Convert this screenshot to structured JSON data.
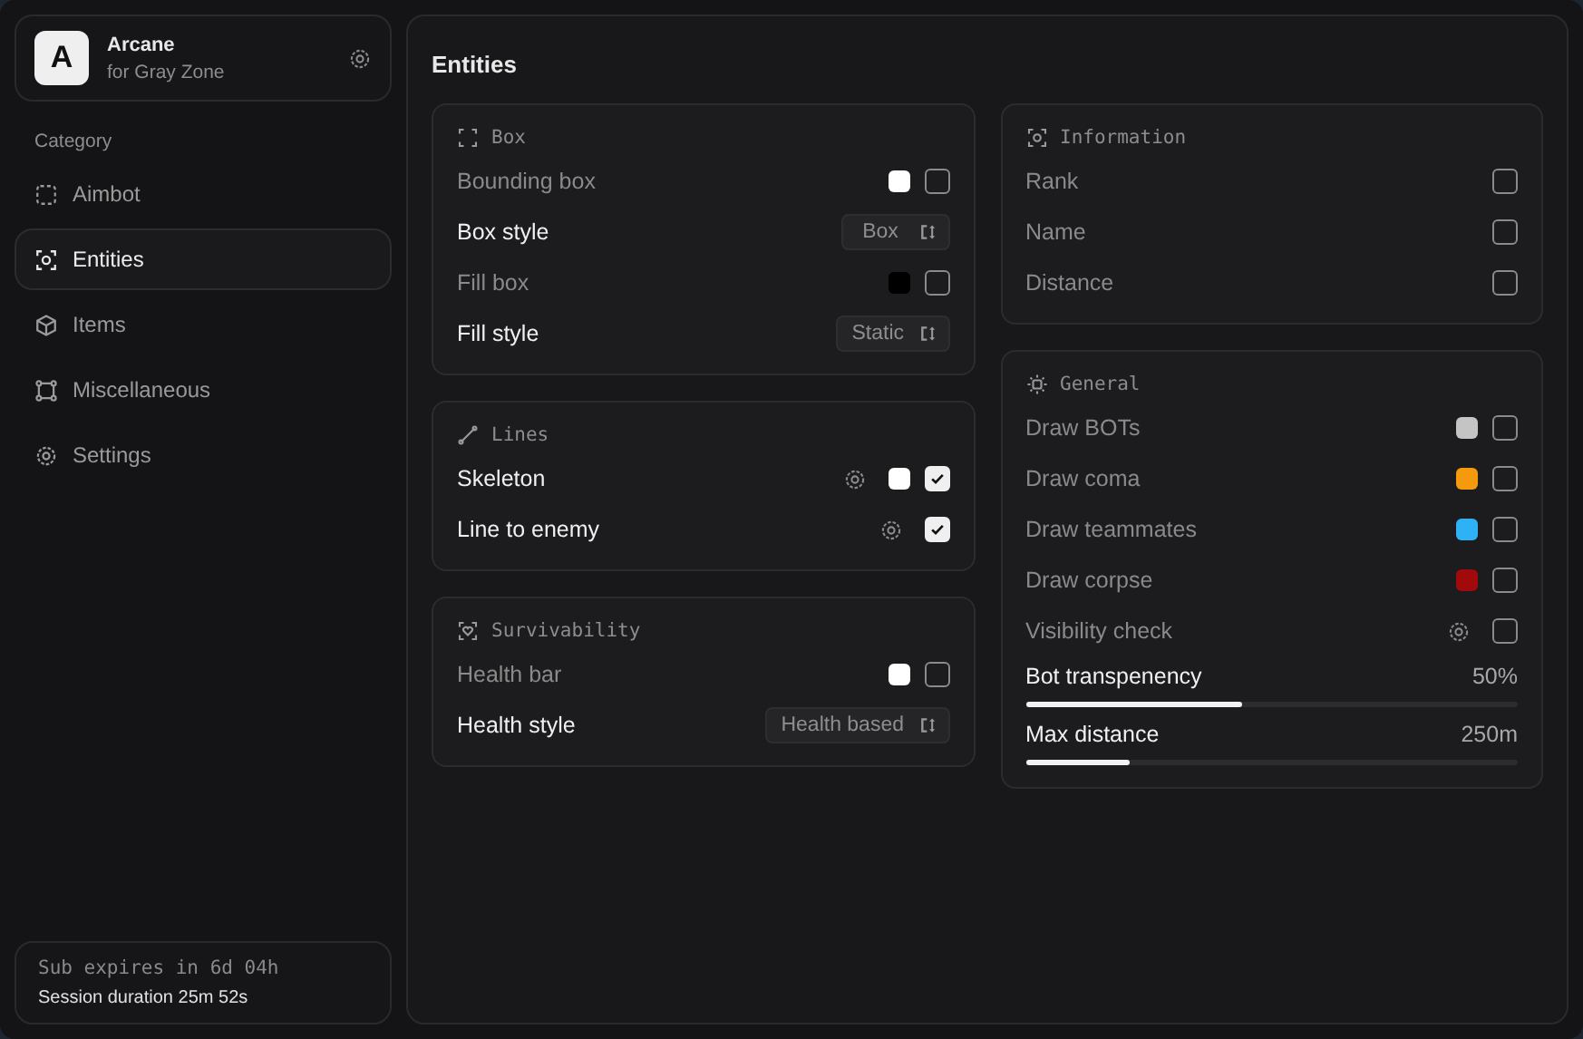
{
  "profile": {
    "logo": "A",
    "name": "Arcane",
    "subtitle": "for Gray Zone"
  },
  "sidebar": {
    "heading": "Category",
    "items": [
      {
        "label": "Aimbot",
        "selected": false
      },
      {
        "label": "Entities",
        "selected": true
      },
      {
        "label": "Items",
        "selected": false
      },
      {
        "label": "Miscellaneous",
        "selected": false
      },
      {
        "label": "Settings",
        "selected": false
      }
    ]
  },
  "footer": {
    "expires": "Sub expires in 6d 04h",
    "session": "Session duration 25m 52s"
  },
  "page_title": "Entities",
  "columns": [
    [
      {
        "title": "Box",
        "rows": [
          {
            "kind": "toggle",
            "label": "Bounding box",
            "color": "#ffffff",
            "checked": false
          },
          {
            "kind": "select",
            "label": "Box style",
            "value": "Box"
          },
          {
            "kind": "toggle",
            "label": "Fill box",
            "color": "#000000",
            "checked": false
          },
          {
            "kind": "select",
            "label": "Fill style",
            "value": "Static"
          }
        ]
      },
      {
        "title": "Lines",
        "rows": [
          {
            "kind": "toggle",
            "label": "Skeleton",
            "settings": true,
            "color": "#ffffff",
            "checked": true
          },
          {
            "kind": "toggle",
            "label": "Line to enemy",
            "settings": true,
            "checked": true
          }
        ]
      },
      {
        "title": "Survivability",
        "rows": [
          {
            "kind": "toggle",
            "label": "Health bar",
            "color": "#ffffff",
            "checked": false
          },
          {
            "kind": "select",
            "label": "Health style",
            "value": "Health based"
          }
        ]
      }
    ],
    [
      {
        "title": "Information",
        "rows": [
          {
            "kind": "toggle",
            "label": "Rank",
            "checked": false
          },
          {
            "kind": "toggle",
            "label": "Name",
            "checked": false
          },
          {
            "kind": "toggle",
            "label": "Distance",
            "checked": false
          }
        ]
      },
      {
        "title": "General",
        "rows": [
          {
            "kind": "toggle",
            "label": "Draw BOTs",
            "color": "#c4c4c4",
            "checked": false
          },
          {
            "kind": "toggle",
            "label": "Draw coma",
            "color": "#f59a0c",
            "checked": false
          },
          {
            "kind": "toggle",
            "label": "Draw teammates",
            "color": "#2eb2f5",
            "checked": false
          },
          {
            "kind": "toggle",
            "label": "Draw corpse",
            "color": "#a10a0a",
            "checked": false
          },
          {
            "kind": "toggle",
            "label": "Visibility check",
            "settings": true,
            "checked": false
          },
          {
            "kind": "slider",
            "label": "Bot transpenency",
            "reading": "50%",
            "level": 0.44
          },
          {
            "kind": "slider",
            "label": "Max distance",
            "reading": "250m",
            "level": 0.21
          }
        ]
      }
    ]
  ]
}
